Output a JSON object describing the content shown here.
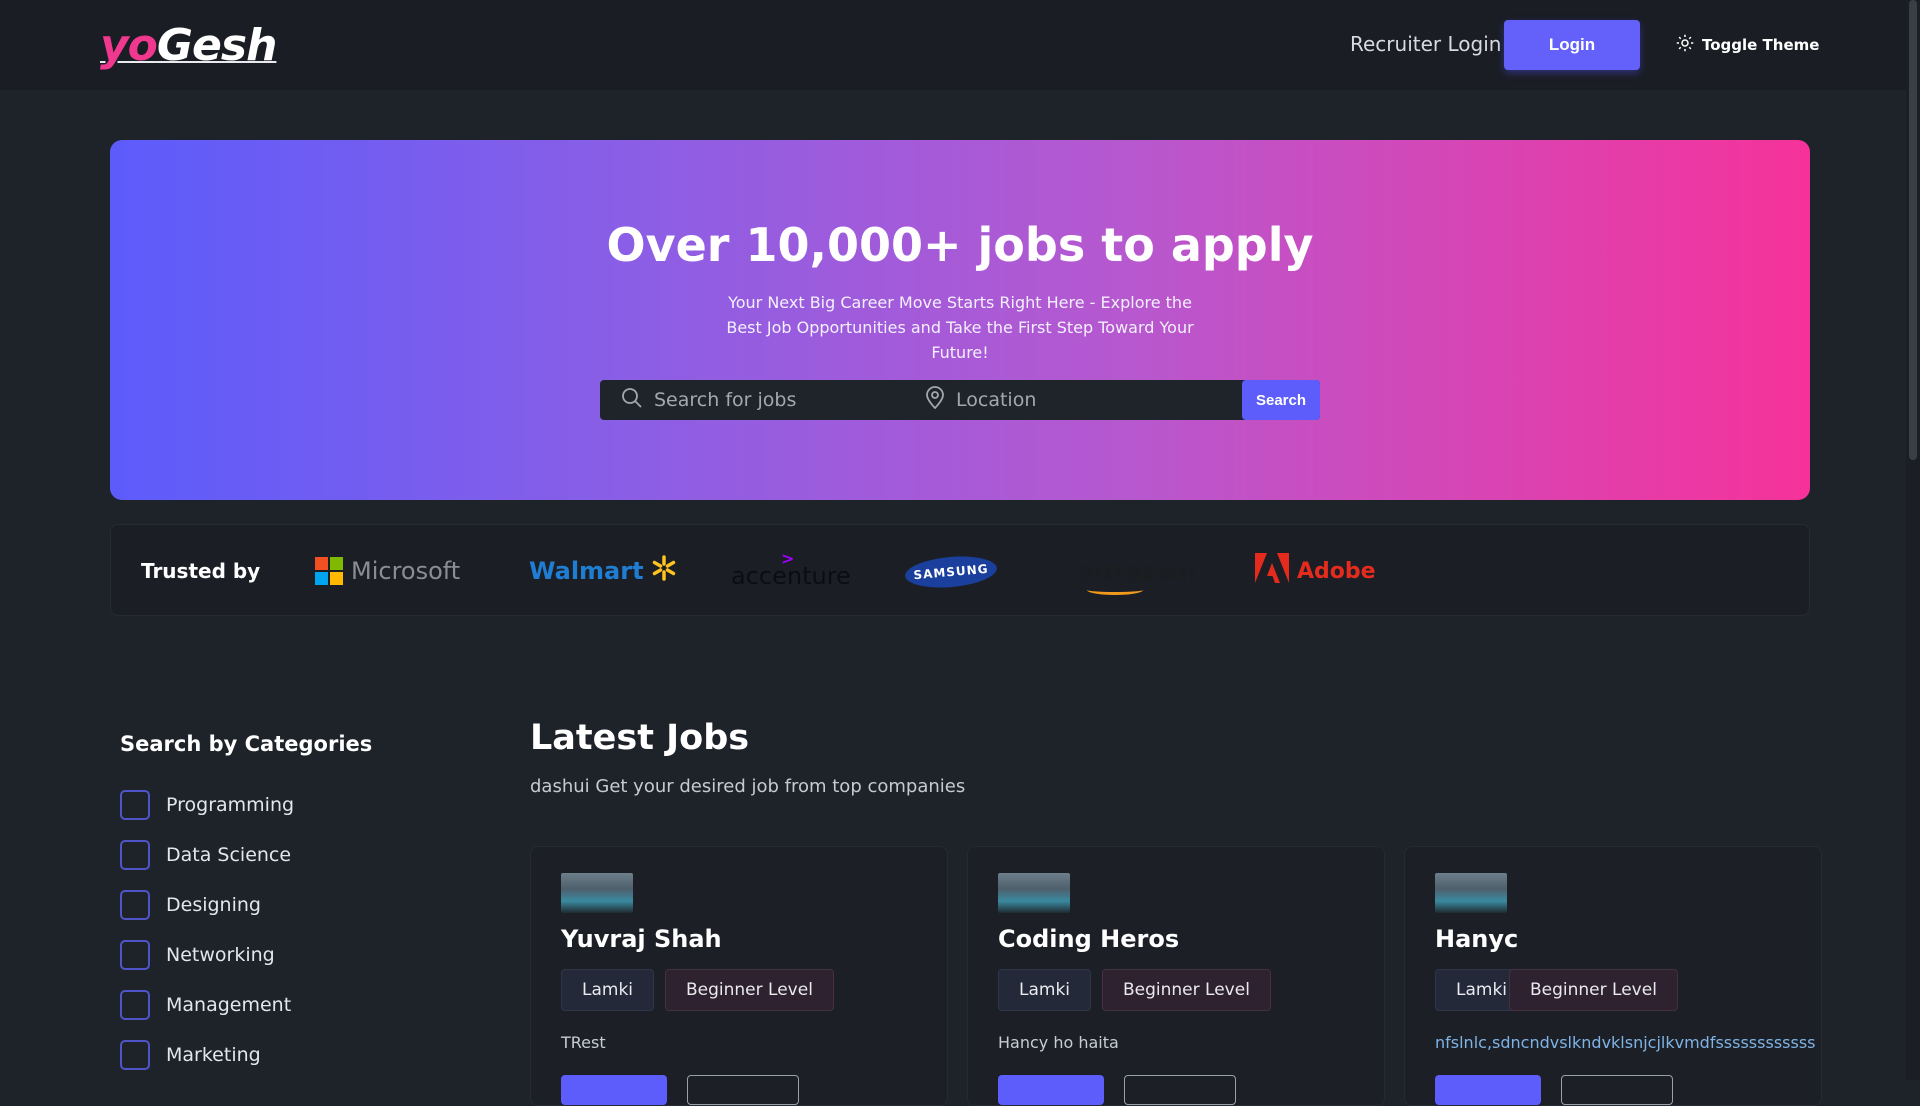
{
  "header": {
    "logo_part1": "yo",
    "logo_part2": "Gesh",
    "recruiter_login": "Recruiter Login",
    "login": "Login",
    "toggle_theme": "Toggle Theme"
  },
  "hero": {
    "title": "Over 10,000+ jobs to apply",
    "subtitle": "Your Next Big Career Move Starts Right Here - Explore the Best Job Opportunities and Take the First Step Toward Your Future!",
    "search_placeholder": "Search for jobs",
    "location_placeholder": "Location",
    "search_button": "Search",
    "gradient_start": "#5c5cfb",
    "gradient_end": "#f6329a"
  },
  "trusted": {
    "label": "Trusted by",
    "brands": [
      "Microsoft",
      "Walmart",
      "accenture",
      "SAMSUNG",
      "amazon",
      "Adobe"
    ]
  },
  "categories": {
    "title": "Search by Categories",
    "items": [
      "Programming",
      "Data Science",
      "Designing",
      "Networking",
      "Management",
      "Marketing"
    ]
  },
  "jobs": {
    "title": "Latest Jobs",
    "subtitle": "dashui Get your desired job from top companies",
    "cards": [
      {
        "name": "Yuvraj Shah",
        "location": "Lamki",
        "level": "Beginner Level",
        "description": "TRest"
      },
      {
        "name": "Coding Heros",
        "location": "Lamki",
        "level": "Beginner Level",
        "description": "Hancy ho haita"
      },
      {
        "name": "Hanyc",
        "location": "Lamki",
        "level": "Beginner Level",
        "description": "nfslnlc,sdncndvslkndvklsnjcjlkvmdfssssssssssss"
      }
    ]
  },
  "colors": {
    "accent": "#5d5dfb",
    "background": "#1e232a",
    "logo_pink": "#f0388f"
  }
}
